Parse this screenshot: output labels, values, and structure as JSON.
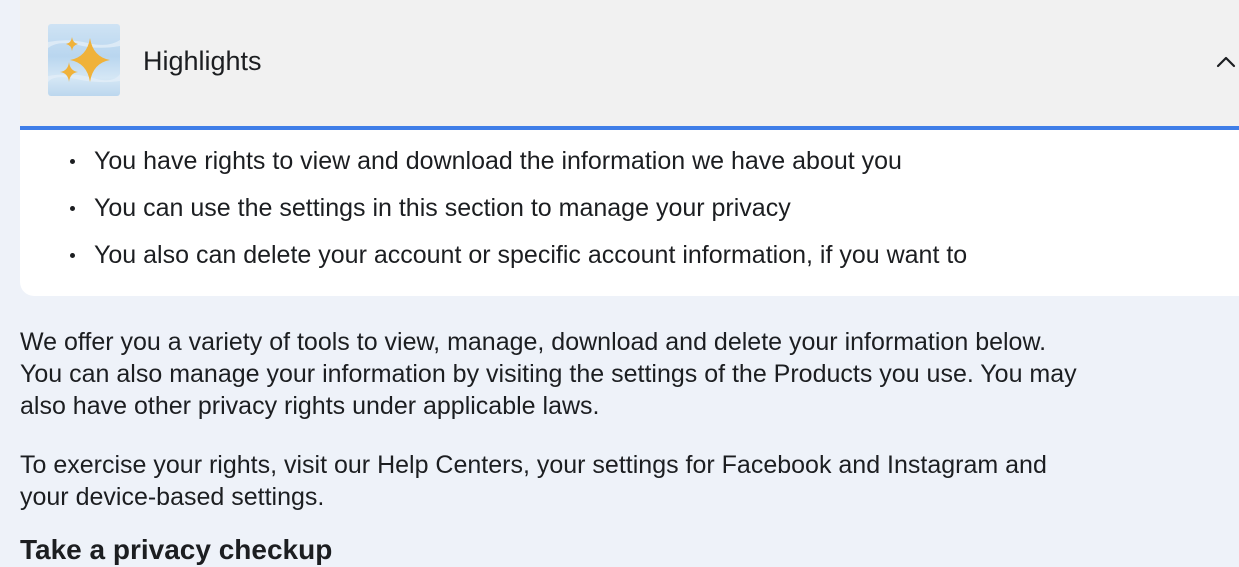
{
  "highlights": {
    "thumbnail_icon": "sparkles-icon",
    "title": "Highlights",
    "toggle_icon": "chevron-up-icon",
    "bullets": [
      "You have rights to view and download the information we have about you",
      "You can use the settings in this section to manage your privacy",
      "You also can delete your account or specific account information, if you want to"
    ]
  },
  "body": {
    "paragraph1_line1": "We offer you a variety of tools to view, manage, download and delete your information below.",
    "paragraph1_line2": "You can also manage your information by visiting the settings of the Products you use. You may",
    "paragraph1_line3": "also have other privacy rights under applicable laws.",
    "paragraph2_line1": "To exercise your rights, visit our Help Centers, your settings for Facebook and Instagram and",
    "paragraph2_line2": "your device-based settings.",
    "next_heading": "Take a privacy checkup"
  },
  "colors": {
    "page_background": "#eef2f9",
    "accent": "#3f7ee8",
    "sparkle": "#f0b23a"
  }
}
